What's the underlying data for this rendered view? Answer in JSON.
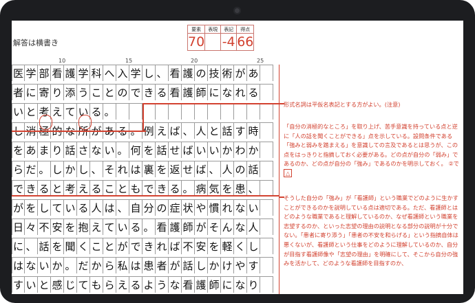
{
  "header": {
    "answer_note": "解答は横書き"
  },
  "score_table": {
    "labels": [
      "要素",
      "表現",
      "表記",
      "得点"
    ],
    "values": [
      "70",
      "",
      "-4",
      "66"
    ]
  },
  "ruler": {
    "marks": [
      "10",
      "15",
      "20",
      "25"
    ]
  },
  "essay_rows": [
    "医学部看護学科へ入学し、看護の技術があ",
    "者に寄り添うことのできる看護師になれる",
    "いと考えている。",
    "し消極的な所がある。例えば、人と話す時",
    "をあまり話さない。何を話せばいいかわか",
    "らだ。しかし、それは裏を返せば、人の話",
    "できると考えることもできる。病気を患、",
    "がをしている人は、自分の症状や慣れない",
    "日々不安を抱えている。看護師がそんな人",
    "に、話を聞くことができれば不安を軽くし",
    "はないか。だから私は患者が話しかけやす",
    "すいと感じてもらえるような看護師になり"
  ],
  "comments": {
    "c1": "形式名詞は平仮名表記とする方がよい。(注意)",
    "c2": "「自分の消極的なところ」を取り上げ、苦手意識を持っている点と逆に「人の話を聞くことができる」点を示している。設問条件である「強みと弱みを踏まえる」を意識しての言及であるとは思うが、この点をはっきりと指摘しておく必要がある。どの点が自分の「弱み」であるのか、どの点が自分の「強み」であるのかを明示しておく。",
    "c2_tag": "②で",
    "c2_badge": "△",
    "c3": "そうした自分の「強み」が「看護師」という職業でどのように生かすことができるのかを説明している点は適切である。ただ、看護師とはどのような職業であると理解しているのか、なぜ看護師という職業を志望するのか、といった志望の理由の説明となる部分の説明が十分でない。「患者に寄り添う」「患者の不安を和らげる」という指摘自体は悪くないが、看護師という仕事をどのように理解しているのか、自分が目指す看護師像や「志望の理由」を明確にして、そこから自分の強みを活かして、どのような看護師を目指すのか、"
  },
  "colors": {
    "bezel": "#1c1d20",
    "accent_red": "#d2412f"
  }
}
